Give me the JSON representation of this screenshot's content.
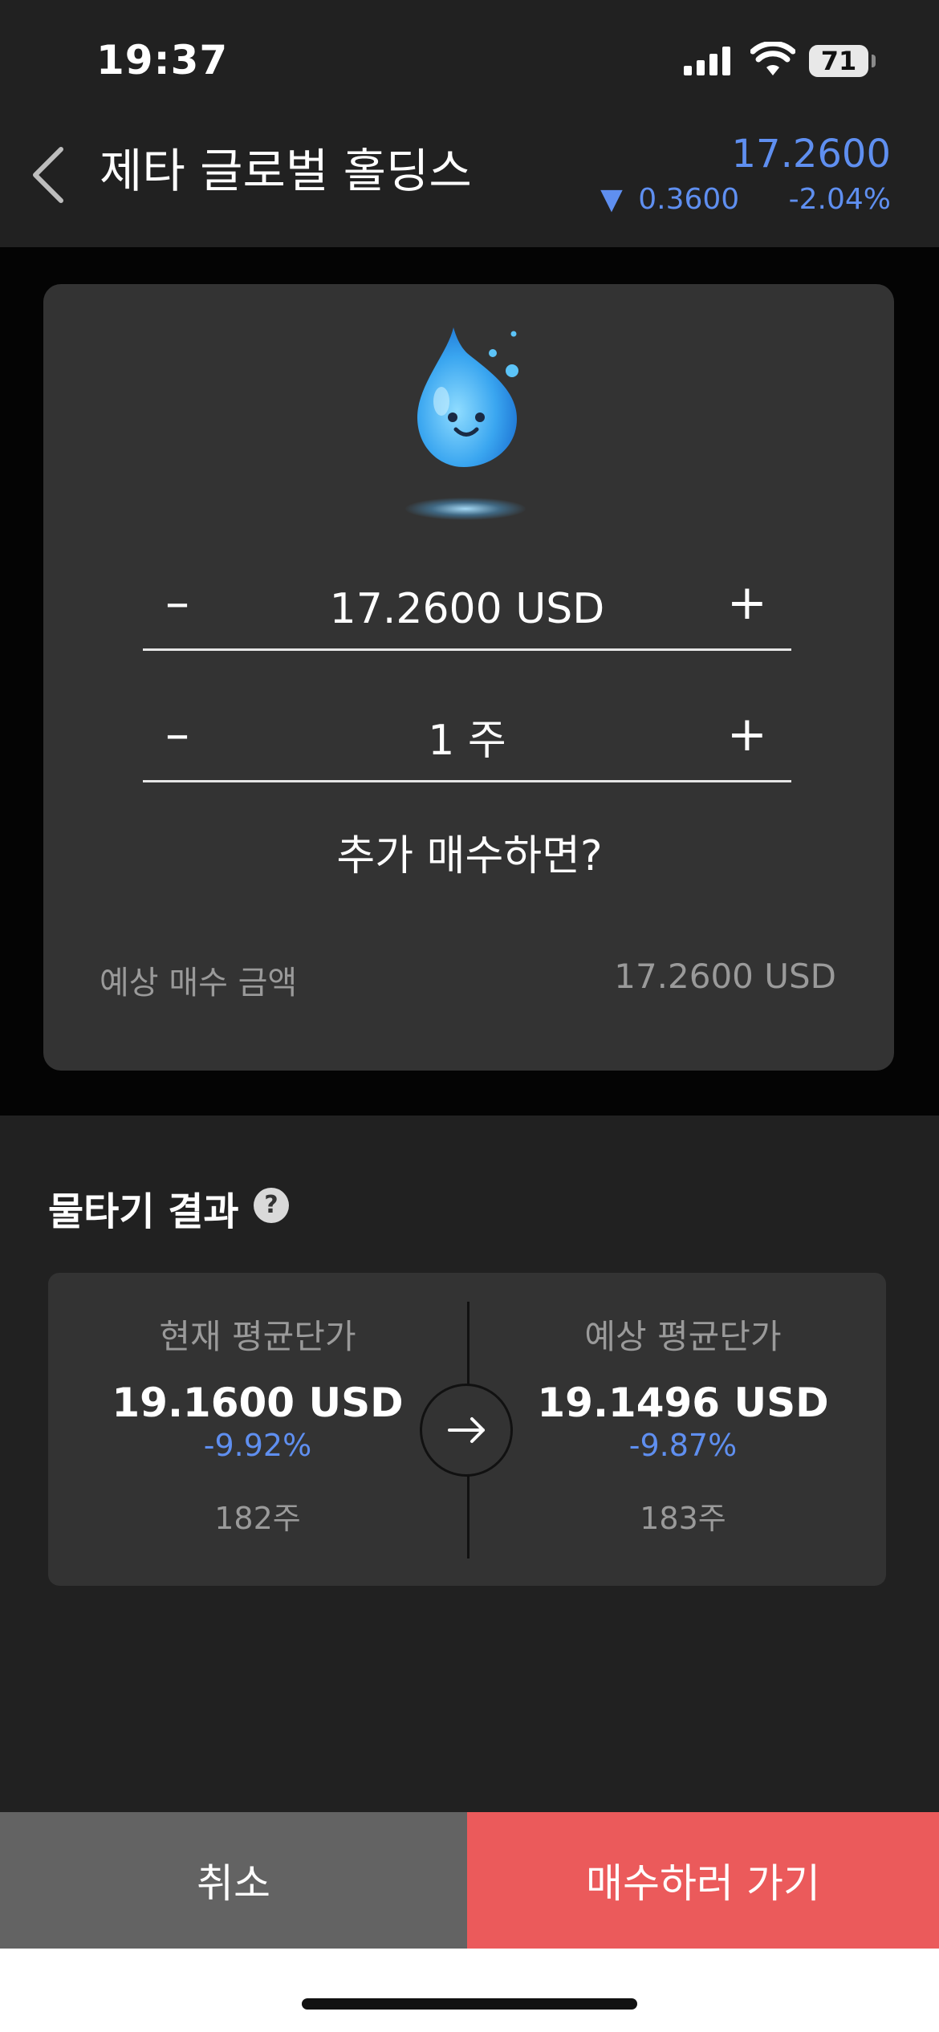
{
  "status_bar": {
    "time": "19:37",
    "battery": "71"
  },
  "header": {
    "title": "제타 글로벌 홀딩스",
    "price": "17.2600",
    "change_arrow": "▼",
    "change_amount": "0.3600",
    "change_percent": "-2.04%"
  },
  "calculator": {
    "price_value": "17.2600 USD",
    "quantity_value": "1 주",
    "minus_label": "–",
    "plus_label": "+",
    "question": "추가 매수하면?",
    "expected_label": "예상 매수 금액",
    "expected_value": "17.2600 USD"
  },
  "result": {
    "title": "물타기 결과",
    "help_icon": "?",
    "current": {
      "label": "현재 평균단가",
      "amount": "19.1600 USD",
      "percent": "-9.92%",
      "shares": "182주"
    },
    "expected": {
      "label": "예상 평균단가",
      "amount": "19.1496 USD",
      "percent": "-9.87%",
      "shares": "183주"
    }
  },
  "buttons": {
    "cancel": "취소",
    "buy": "매수하러 가기"
  },
  "colors": {
    "accent_blue": "#5f8ff0",
    "buy_red": "#eb5a5b",
    "cancel_gray": "#636363",
    "card": "#333333",
    "background": "#212121"
  },
  "icons": [
    "signal-icon",
    "wifi-icon",
    "battery-icon",
    "back-chevron-icon",
    "water-drop-mascot-icon",
    "question-icon",
    "arrow-right-icon"
  ]
}
